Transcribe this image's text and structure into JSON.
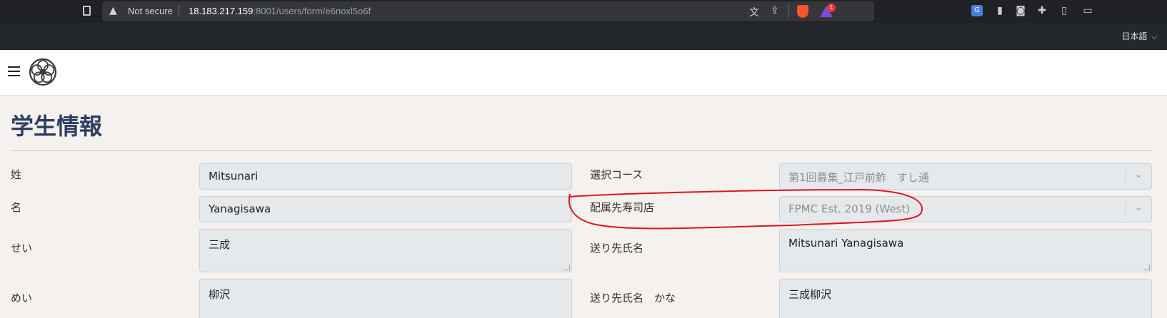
{
  "browser": {
    "not_secure": "Not secure",
    "url_host": "18.183.217.159",
    "url_rest": ":8001/users/form/e6noxl5o6f",
    "vpn_badge": "1",
    "language": "日本語",
    "icons": [
      "bookmark-icon",
      "warning-icon",
      "translate-icon",
      "share-icon",
      "brave-shield-icon",
      "brave-rewards-icon",
      "google-translate-icon",
      "notes-icon",
      "camera-icon",
      "puzzle-icon",
      "sidebar-icon",
      "wallet-icon"
    ]
  },
  "page": {
    "title": "学生情報"
  },
  "form": {
    "left": [
      {
        "label": "姓",
        "value": "Mitsunari"
      },
      {
        "label": "名",
        "value": "Yanagisawa"
      },
      {
        "label": "せい",
        "value": "三成"
      },
      {
        "label": "めい",
        "value": "柳沢"
      }
    ],
    "right": [
      {
        "label": "選択コース",
        "value": "第1回募集_江戸前鮓　すし通"
      },
      {
        "label": "配属先寿司店",
        "value": "FPMC Est. 2019 (West)"
      },
      {
        "label": "送り先氏名",
        "value": "Mitsunari Yanagisawa"
      },
      {
        "label": "送り先氏名　かな",
        "value": "三成柳沢"
      }
    ]
  },
  "annotation": {
    "color": "#e0141e"
  }
}
